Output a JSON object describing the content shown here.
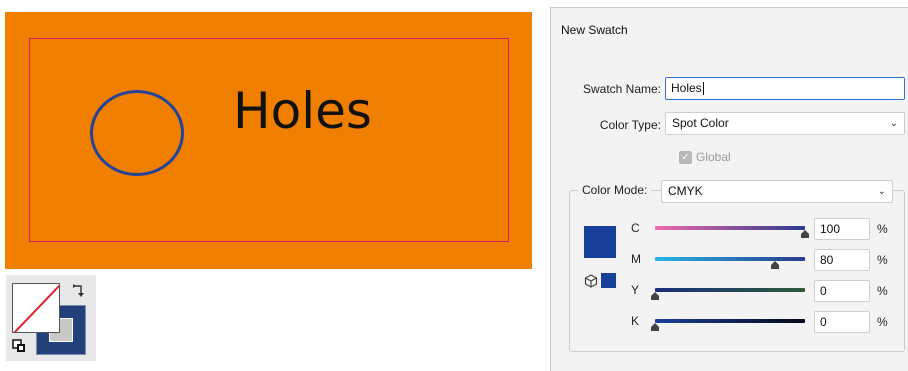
{
  "artwork": {
    "label": "Holes",
    "colors": {
      "background": "#f07f00",
      "frame": "#d81b60",
      "circle": "#23449a"
    }
  },
  "fill_stroke_widget": {
    "fill": "none",
    "stroke": "#23407a",
    "icons": [
      "none-swatch-icon",
      "swap-arrow-icon",
      "default-colors-icon"
    ]
  },
  "dialog": {
    "title": "New Swatch",
    "swatch_name": {
      "label": "Swatch Name:",
      "value": "Holes"
    },
    "color_type": {
      "label": "Color Type:",
      "value": "Spot Color"
    },
    "global": {
      "label": "Global",
      "checked": true,
      "disabled": true
    },
    "color_mode": {
      "label": "Color Mode:",
      "value": "CMYK"
    },
    "preview_color": "#1a3f9a",
    "sliders": [
      {
        "label": "C",
        "value": "100",
        "unit": "%",
        "fraction": 1.0
      },
      {
        "label": "M",
        "value": "80",
        "unit": "%",
        "fraction": 0.8
      },
      {
        "label": "Y",
        "value": "0",
        "unit": "%",
        "fraction": 0.0
      },
      {
        "label": "K",
        "value": "0",
        "unit": "%",
        "fraction": 0.0
      }
    ]
  }
}
